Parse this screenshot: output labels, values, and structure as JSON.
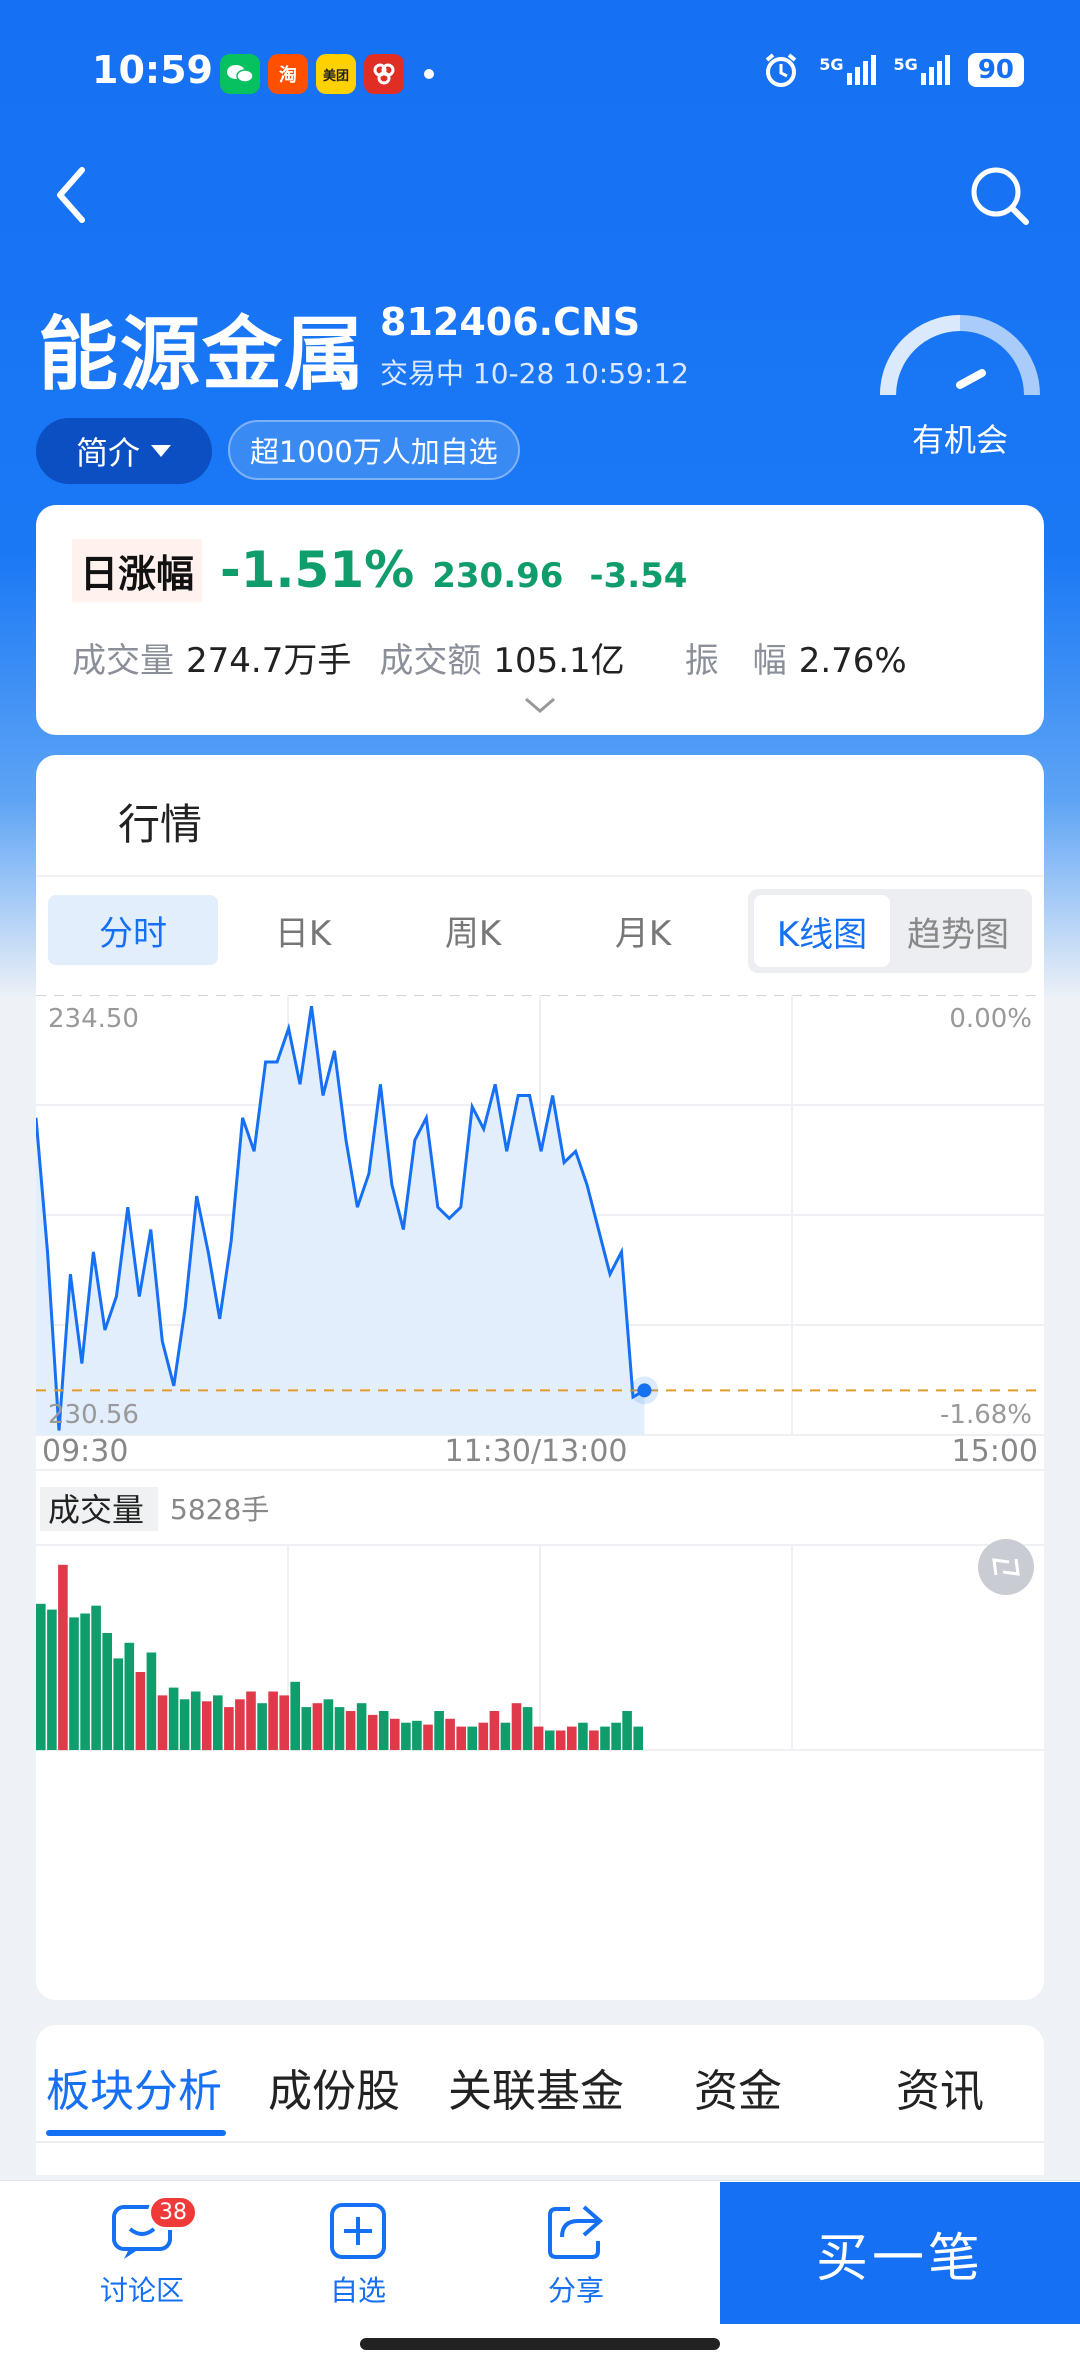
{
  "status_bar": {
    "time": "10:59",
    "apps": [
      {
        "name": "wechat-icon",
        "text": "",
        "color": "#07c160"
      },
      {
        "name": "taobao-icon",
        "text": "淘",
        "color": "#ff5000"
      },
      {
        "name": "meituan-icon",
        "text": "美团",
        "color": "#ffd100"
      },
      {
        "name": "pinduoduo-icon",
        "text": "",
        "color": "#e02e24"
      }
    ],
    "signal1": "5G",
    "signal2": "5G",
    "battery": "90"
  },
  "header": {
    "name": "能源金属",
    "code": "812406.CNS",
    "trade_status": "交易中 10-28 10:59:12",
    "intro_label": "简介",
    "fav_badge": "超1000万人加自选",
    "gauge_label": "有机会"
  },
  "quote": {
    "label": "日涨幅",
    "pct": "-1.51%",
    "price": "230.96",
    "change": "-3.54",
    "stats": [
      {
        "k": "成交量",
        "v": "274.7万手"
      },
      {
        "k": "成交额",
        "v": "105.1亿"
      },
      {
        "k": "振　幅",
        "v": "2.76%"
      }
    ]
  },
  "market": {
    "title": "行情",
    "tabs": [
      "分时",
      "日K",
      "周K",
      "月K"
    ],
    "active_tab": 0,
    "toggle": [
      "K线图",
      "趋势图"
    ],
    "toggle_active": 0
  },
  "chart_data": {
    "type": "line",
    "y_top_label": "234.50",
    "y_bottom_label": "230.56",
    "right_top_label": "0.00%",
    "right_bottom_label": "-1.68%",
    "x_labels": [
      "09:30",
      "11:30/13:00",
      "15:00"
    ],
    "ylim": [
      230.56,
      234.5
    ],
    "prev_close": 234.5,
    "last_price": 230.96,
    "total_minutes": 240,
    "series": [
      {
        "values": [
          233.4,
          232.2,
          230.6,
          232.0,
          231.2,
          232.2,
          231.5,
          231.8,
          232.6,
          231.8,
          232.4,
          231.4,
          231.0,
          231.7,
          232.7,
          232.2,
          231.6,
          232.3,
          233.4,
          233.1,
          233.9,
          233.9,
          234.2,
          233.7,
          234.4,
          233.6,
          234.0,
          233.2,
          232.6,
          232.9,
          233.7,
          232.8,
          232.4,
          233.2,
          233.4,
          232.6,
          232.5,
          232.6,
          233.5,
          233.3,
          233.7,
          233.1,
          233.6,
          233.6,
          233.1,
          233.6,
          233.0,
          233.1,
          232.8,
          232.4,
          232.0,
          232.2,
          230.9,
          230.96
        ]
      }
    ],
    "volume": {
      "label": "成交量",
      "value": "5828手",
      "bars": [
        {
          "v": 0.75,
          "c": "g"
        },
        {
          "v": 0.72,
          "c": "g"
        },
        {
          "v": 0.95,
          "c": "r"
        },
        {
          "v": 0.68,
          "c": "g"
        },
        {
          "v": 0.7,
          "c": "g"
        },
        {
          "v": 0.74,
          "c": "g"
        },
        {
          "v": 0.6,
          "c": "g"
        },
        {
          "v": 0.47,
          "c": "g"
        },
        {
          "v": 0.55,
          "c": "g"
        },
        {
          "v": 0.4,
          "c": "r"
        },
        {
          "v": 0.5,
          "c": "g"
        },
        {
          "v": 0.28,
          "c": "r"
        },
        {
          "v": 0.32,
          "c": "g"
        },
        {
          "v": 0.26,
          "c": "g"
        },
        {
          "v": 0.3,
          "c": "g"
        },
        {
          "v": 0.25,
          "c": "r"
        },
        {
          "v": 0.28,
          "c": "g"
        },
        {
          "v": 0.22,
          "c": "r"
        },
        {
          "v": 0.26,
          "c": "r"
        },
        {
          "v": 0.3,
          "c": "r"
        },
        {
          "v": 0.24,
          "c": "g"
        },
        {
          "v": 0.3,
          "c": "r"
        },
        {
          "v": 0.28,
          "c": "r"
        },
        {
          "v": 0.35,
          "c": "g"
        },
        {
          "v": 0.22,
          "c": "g"
        },
        {
          "v": 0.24,
          "c": "r"
        },
        {
          "v": 0.26,
          "c": "g"
        },
        {
          "v": 0.22,
          "c": "g"
        },
        {
          "v": 0.2,
          "c": "r"
        },
        {
          "v": 0.24,
          "c": "g"
        },
        {
          "v": 0.18,
          "c": "r"
        },
        {
          "v": 0.2,
          "c": "g"
        },
        {
          "v": 0.16,
          "c": "r"
        },
        {
          "v": 0.14,
          "c": "g"
        },
        {
          "v": 0.15,
          "c": "g"
        },
        {
          "v": 0.13,
          "c": "r"
        },
        {
          "v": 0.2,
          "c": "g"
        },
        {
          "v": 0.16,
          "c": "r"
        },
        {
          "v": 0.12,
          "c": "r"
        },
        {
          "v": 0.12,
          "c": "g"
        },
        {
          "v": 0.14,
          "c": "r"
        },
        {
          "v": 0.2,
          "c": "r"
        },
        {
          "v": 0.14,
          "c": "g"
        },
        {
          "v": 0.24,
          "c": "r"
        },
        {
          "v": 0.22,
          "c": "g"
        },
        {
          "v": 0.12,
          "c": "r"
        },
        {
          "v": 0.1,
          "c": "g"
        },
        {
          "v": 0.1,
          "c": "r"
        },
        {
          "v": 0.12,
          "c": "r"
        },
        {
          "v": 0.14,
          "c": "g"
        },
        {
          "v": 0.1,
          "c": "r"
        },
        {
          "v": 0.12,
          "c": "g"
        },
        {
          "v": 0.14,
          "c": "g"
        },
        {
          "v": 0.2,
          "c": "g"
        },
        {
          "v": 0.12,
          "c": "g"
        }
      ]
    }
  },
  "sections": [
    "板块分析",
    "成份股",
    "关联基金",
    "资金",
    "资讯"
  ],
  "bottom_bar": {
    "items": [
      {
        "label": "讨论区",
        "badge": "38"
      },
      {
        "label": "自选"
      },
      {
        "label": "分享"
      }
    ],
    "buy": "买一笔"
  },
  "colors": {
    "brand_blue": "#1670f3",
    "down_green": "#0f9d6b",
    "up_red": "#e0394a",
    "prev_close_dash": "#e39b2a"
  }
}
